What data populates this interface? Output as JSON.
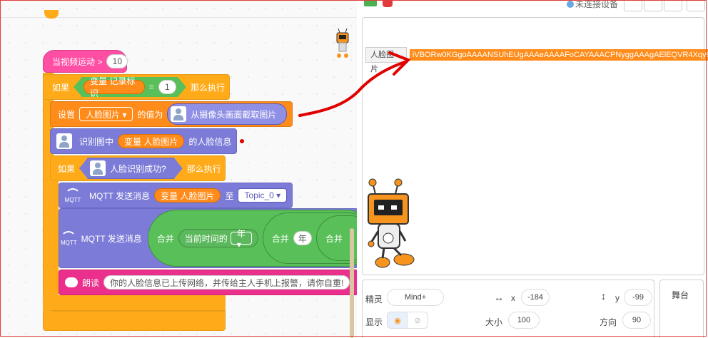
{
  "toolbar": {
    "connection_status": "未连接设备"
  },
  "stage": {
    "monitor_label": "人脸图片",
    "monitor_value": "iVBORw0KGgoAAAANSUhEUgAAAeAAAAFoCAYAAACPNyggAAAgAElEQVR4Xqy9CbNk2X"
  },
  "script": {
    "hat_label": "当视频运动 >",
    "hat_value": "10",
    "if1_label": "如果",
    "if1_var": "变量 记录标识",
    "if1_eq": "=",
    "if1_value": "1",
    "if1_then": "那么执行",
    "set_label": "设置",
    "set_var": "人脸图片 ▾",
    "set_mid": "的值为",
    "set_reporter": "从摄像头画面截取图片",
    "recog_prefix": "识别图中",
    "recog_var": "变量 人脸图片",
    "recog_suffix": "的人脸信息",
    "if2_label": "如果",
    "if2_cond": "人脸识别成功?",
    "if2_then": "那么执行",
    "mqtt_icon_text": "MQTT",
    "mqtt1_label": "MQTT 发送消息",
    "mqtt1_var": "变量 人脸图片",
    "mqtt1_to": "至",
    "mqtt1_topic": "Topic_0 ▾",
    "mqtt2_label": "MQTT 发送消息",
    "join1": "合并",
    "time_label": "当前时间的",
    "time_unit": "年 ▾",
    "join2": "合并",
    "year_value": "年",
    "join3": "合并",
    "speak_label": "朗读",
    "speak_text": "你的人脸信息已上传网络，并传给主人手机上报警，请你自重!"
  },
  "sprite_panel": {
    "sprite_label": "精灵",
    "sprite_name": "Mind+",
    "x_label": "x",
    "x_value": "-184",
    "y_label": "y",
    "y_value": "-99",
    "show_label": "显示",
    "size_label": "大小",
    "size_value": "100",
    "direction_label": "方向",
    "direction_value": "90"
  },
  "stage_tab": {
    "label": "舞台"
  },
  "colors": {
    "event": "#ff4fa4",
    "control": "#ffab19",
    "extension": "#7c7cd8",
    "variable": "#ff8c1a",
    "speech": "#ea2f8c",
    "annotation": "#e00000"
  }
}
